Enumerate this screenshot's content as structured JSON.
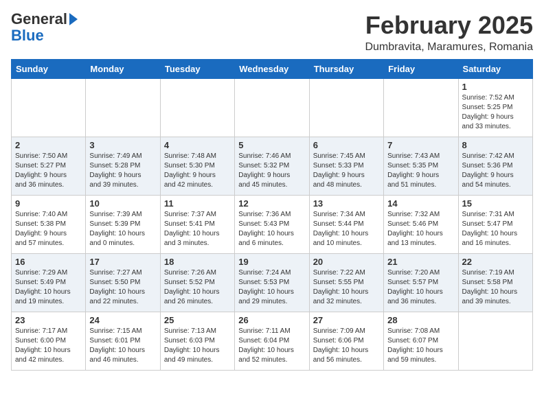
{
  "header": {
    "logo_line1": "General",
    "logo_line2": "Blue",
    "title": "February 2025",
    "subtitle": "Dumbravita, Maramures, Romania"
  },
  "weekdays": [
    "Sunday",
    "Monday",
    "Tuesday",
    "Wednesday",
    "Thursday",
    "Friday",
    "Saturday"
  ],
  "weeks": [
    [
      {
        "day": "",
        "info": ""
      },
      {
        "day": "",
        "info": ""
      },
      {
        "day": "",
        "info": ""
      },
      {
        "day": "",
        "info": ""
      },
      {
        "day": "",
        "info": ""
      },
      {
        "day": "",
        "info": ""
      },
      {
        "day": "1",
        "info": "Sunrise: 7:52 AM\nSunset: 5:25 PM\nDaylight: 9 hours\nand 33 minutes."
      }
    ],
    [
      {
        "day": "2",
        "info": "Sunrise: 7:50 AM\nSunset: 5:27 PM\nDaylight: 9 hours\nand 36 minutes."
      },
      {
        "day": "3",
        "info": "Sunrise: 7:49 AM\nSunset: 5:28 PM\nDaylight: 9 hours\nand 39 minutes."
      },
      {
        "day": "4",
        "info": "Sunrise: 7:48 AM\nSunset: 5:30 PM\nDaylight: 9 hours\nand 42 minutes."
      },
      {
        "day": "5",
        "info": "Sunrise: 7:46 AM\nSunset: 5:32 PM\nDaylight: 9 hours\nand 45 minutes."
      },
      {
        "day": "6",
        "info": "Sunrise: 7:45 AM\nSunset: 5:33 PM\nDaylight: 9 hours\nand 48 minutes."
      },
      {
        "day": "7",
        "info": "Sunrise: 7:43 AM\nSunset: 5:35 PM\nDaylight: 9 hours\nand 51 minutes."
      },
      {
        "day": "8",
        "info": "Sunrise: 7:42 AM\nSunset: 5:36 PM\nDaylight: 9 hours\nand 54 minutes."
      }
    ],
    [
      {
        "day": "9",
        "info": "Sunrise: 7:40 AM\nSunset: 5:38 PM\nDaylight: 9 hours\nand 57 minutes."
      },
      {
        "day": "10",
        "info": "Sunrise: 7:39 AM\nSunset: 5:39 PM\nDaylight: 10 hours\nand 0 minutes."
      },
      {
        "day": "11",
        "info": "Sunrise: 7:37 AM\nSunset: 5:41 PM\nDaylight: 10 hours\nand 3 minutes."
      },
      {
        "day": "12",
        "info": "Sunrise: 7:36 AM\nSunset: 5:43 PM\nDaylight: 10 hours\nand 6 minutes."
      },
      {
        "day": "13",
        "info": "Sunrise: 7:34 AM\nSunset: 5:44 PM\nDaylight: 10 hours\nand 10 minutes."
      },
      {
        "day": "14",
        "info": "Sunrise: 7:32 AM\nSunset: 5:46 PM\nDaylight: 10 hours\nand 13 minutes."
      },
      {
        "day": "15",
        "info": "Sunrise: 7:31 AM\nSunset: 5:47 PM\nDaylight: 10 hours\nand 16 minutes."
      }
    ],
    [
      {
        "day": "16",
        "info": "Sunrise: 7:29 AM\nSunset: 5:49 PM\nDaylight: 10 hours\nand 19 minutes."
      },
      {
        "day": "17",
        "info": "Sunrise: 7:27 AM\nSunset: 5:50 PM\nDaylight: 10 hours\nand 22 minutes."
      },
      {
        "day": "18",
        "info": "Sunrise: 7:26 AM\nSunset: 5:52 PM\nDaylight: 10 hours\nand 26 minutes."
      },
      {
        "day": "19",
        "info": "Sunrise: 7:24 AM\nSunset: 5:53 PM\nDaylight: 10 hours\nand 29 minutes."
      },
      {
        "day": "20",
        "info": "Sunrise: 7:22 AM\nSunset: 5:55 PM\nDaylight: 10 hours\nand 32 minutes."
      },
      {
        "day": "21",
        "info": "Sunrise: 7:20 AM\nSunset: 5:57 PM\nDaylight: 10 hours\nand 36 minutes."
      },
      {
        "day": "22",
        "info": "Sunrise: 7:19 AM\nSunset: 5:58 PM\nDaylight: 10 hours\nand 39 minutes."
      }
    ],
    [
      {
        "day": "23",
        "info": "Sunrise: 7:17 AM\nSunset: 6:00 PM\nDaylight: 10 hours\nand 42 minutes."
      },
      {
        "day": "24",
        "info": "Sunrise: 7:15 AM\nSunset: 6:01 PM\nDaylight: 10 hours\nand 46 minutes."
      },
      {
        "day": "25",
        "info": "Sunrise: 7:13 AM\nSunset: 6:03 PM\nDaylight: 10 hours\nand 49 minutes."
      },
      {
        "day": "26",
        "info": "Sunrise: 7:11 AM\nSunset: 6:04 PM\nDaylight: 10 hours\nand 52 minutes."
      },
      {
        "day": "27",
        "info": "Sunrise: 7:09 AM\nSunset: 6:06 PM\nDaylight: 10 hours\nand 56 minutes."
      },
      {
        "day": "28",
        "info": "Sunrise: 7:08 AM\nSunset: 6:07 PM\nDaylight: 10 hours\nand 59 minutes."
      },
      {
        "day": "",
        "info": ""
      }
    ]
  ]
}
